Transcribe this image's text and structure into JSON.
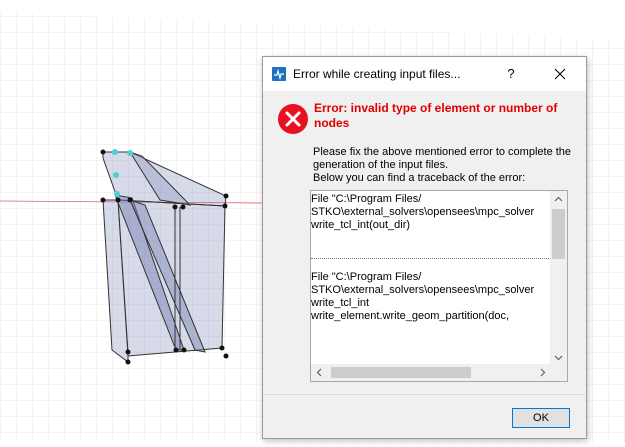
{
  "dialog": {
    "title": "Error while creating input files...",
    "help_label": "?",
    "error_heading": "Error: invalid type of element or number of nodes",
    "message_lines": [
      "Please fix the above mentioned error to complete the",
      "generation of the input files.",
      "Below you can find a traceback of the error:"
    ],
    "traceback": [
      {
        "lines": [
          "  File \"C:\\Program Files/",
          "STKO\\external_solvers\\opensees\\mpc_solver",
          "    write_tcl_int(out_dir)"
        ]
      },
      {
        "lines": [
          "  File \"C:\\Program Files/",
          "STKO\\external_solvers\\opensees\\mpc_solver",
          "write_tcl_int",
          "    write_element.write_geom_partition(doc,"
        ]
      }
    ],
    "ok_label": "OK"
  },
  "colors": {
    "error_red": "#e00000",
    "accent": "#0078d7",
    "app_icon": "#1e73be"
  },
  "icons": {
    "app": "stko-app-icon",
    "error": "error-x-icon",
    "close": "close-icon"
  }
}
